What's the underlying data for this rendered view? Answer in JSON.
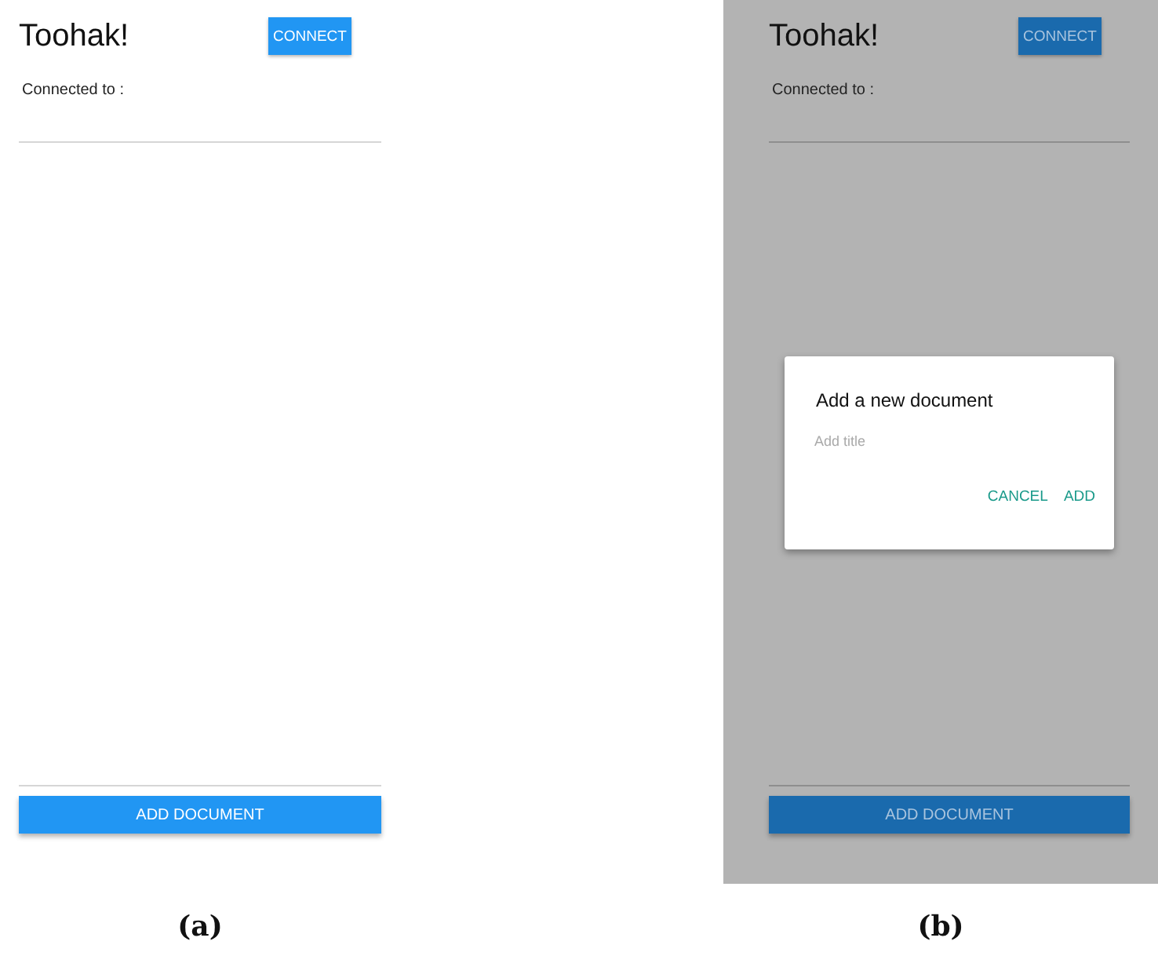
{
  "screens": [
    {
      "caption": "(a)",
      "title": "Toohak!",
      "connect_button": "CONNECT",
      "connected_label": "Connected to :",
      "add_button": "ADD DOCUMENT",
      "dimmed": false
    },
    {
      "caption": "(b)",
      "title": "Toohak!",
      "connect_button": "CONNECT",
      "connected_label": "Connected to :",
      "add_button": "ADD DOCUMENT",
      "dimmed": true,
      "dialog": {
        "title": "Add a new document",
        "field": {
          "placeholder": "Add title"
        },
        "buttons": [
          "CANCEL",
          "ADD"
        ]
      }
    }
  ]
}
